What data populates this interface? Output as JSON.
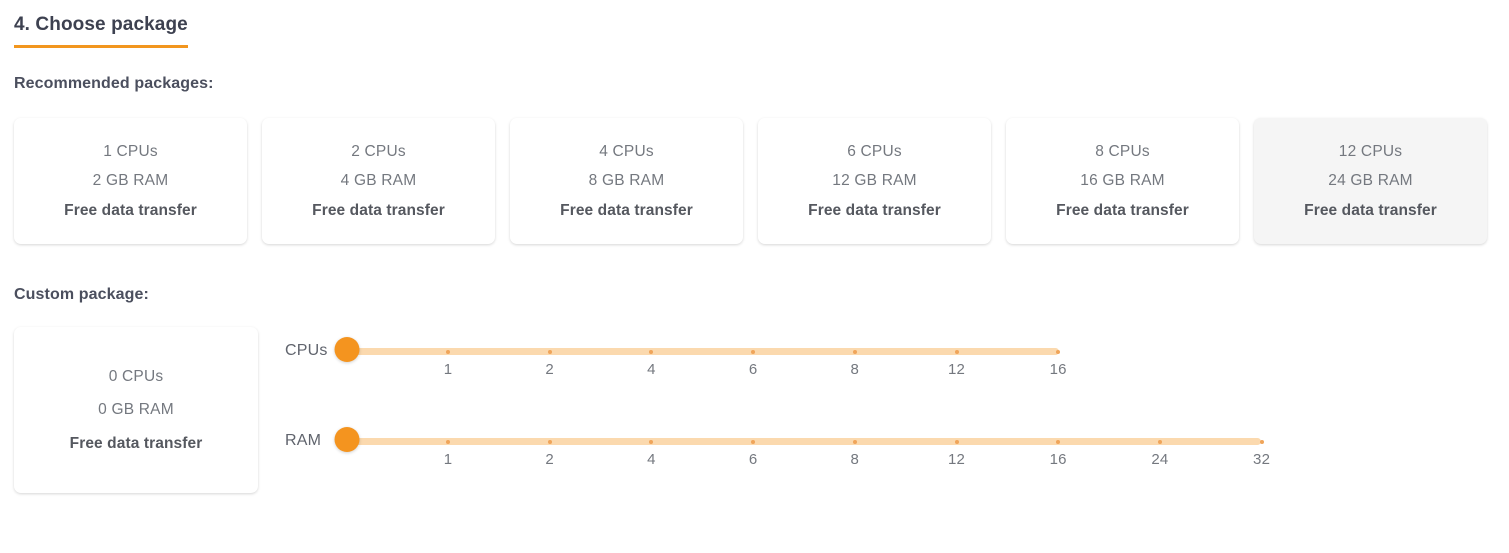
{
  "section": {
    "title": "4. Choose package",
    "accent_color": "#f2961e"
  },
  "recommended": {
    "label": "Recommended packages:",
    "packages": [
      {
        "cpus": "1 CPUs",
        "ram": "2 GB RAM",
        "transfer": "Free data transfer",
        "selected": false
      },
      {
        "cpus": "2 CPUs",
        "ram": "4 GB RAM",
        "transfer": "Free data transfer",
        "selected": false
      },
      {
        "cpus": "4 CPUs",
        "ram": "8 GB RAM",
        "transfer": "Free data transfer",
        "selected": false
      },
      {
        "cpus": "6 CPUs",
        "ram": "12 GB RAM",
        "transfer": "Free data transfer",
        "selected": false
      },
      {
        "cpus": "8 CPUs",
        "ram": "16 GB RAM",
        "transfer": "Free data transfer",
        "selected": false
      },
      {
        "cpus": "12 CPUs",
        "ram": "24 GB RAM",
        "transfer": "Free data transfer",
        "selected": true
      }
    ]
  },
  "custom": {
    "label": "Custom package:",
    "summary": {
      "cpus": "0 CPUs",
      "ram": "0 GB RAM",
      "transfer": "Free data transfer"
    },
    "sliders": [
      {
        "name": "cpus",
        "label": "CPUs",
        "value": 0,
        "value_index": 0,
        "ticks": [
          "1",
          "2",
          "4",
          "6",
          "8",
          "12",
          "16"
        ],
        "track_width": 712,
        "thumb_offset": 0,
        "first_tick_offset": 101,
        "tick_spacing": 101.7
      },
      {
        "name": "ram",
        "label": "RAM",
        "value": 0,
        "value_index": 0,
        "ticks": [
          "1",
          "2",
          "4",
          "6",
          "8",
          "12",
          "16",
          "24",
          "32"
        ],
        "track_width": 914,
        "thumb_offset": 0,
        "first_tick_offset": 101,
        "tick_spacing": 101.7
      }
    ]
  },
  "colors": {
    "accent": "#f2961e",
    "thumb": "#f4941f",
    "track": "#fbd9ae",
    "tick": "#f0a55a",
    "text_muted": "#74787f",
    "text_dark": "#3d4150"
  }
}
